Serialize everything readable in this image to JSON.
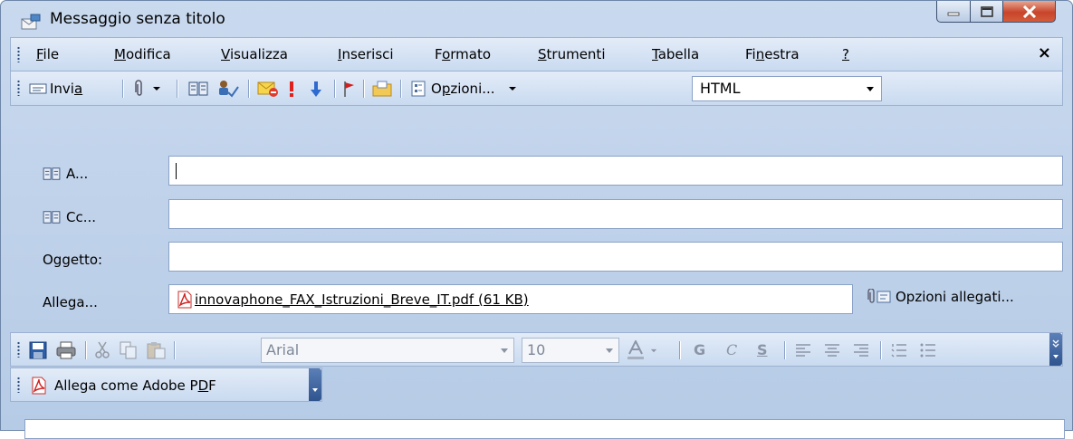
{
  "window": {
    "title": "Messaggio senza titolo"
  },
  "menu": {
    "items": [
      {
        "pre": "",
        "key": "F",
        "post": "ile"
      },
      {
        "pre": "",
        "key": "M",
        "post": "odifica"
      },
      {
        "pre": "",
        "key": "V",
        "post": "isualizza"
      },
      {
        "pre": "",
        "key": "I",
        "post": "nserisci"
      },
      {
        "pre": "F",
        "key": "o",
        "post": "rmato"
      },
      {
        "pre": "",
        "key": "S",
        "post": "trumenti"
      },
      {
        "pre": "",
        "key": "T",
        "post": "abella"
      },
      {
        "pre": "Fi",
        "key": "n",
        "post": "estra"
      },
      {
        "pre": "",
        "key": "?",
        "post": ""
      }
    ],
    "close": "×"
  },
  "toolbar": {
    "send_pre": "Invi",
    "send_key": "a",
    "options_pre": "O",
    "options_key": "p",
    "options_post": "zioni...",
    "format_value": "HTML"
  },
  "fields": {
    "to_label": "A...",
    "cc_label": "Cc...",
    "subject_label": "Oggetto:",
    "attach_label": "Allega...",
    "attachment": "innovaphone_FAX_Istruzioni_Breve_IT.pdf (61 KB)",
    "attach_options": "Opzioni allegati..."
  },
  "format": {
    "font": "Arial",
    "size": "10",
    "bold": "G",
    "italic": "C",
    "underline": "S"
  },
  "pdf_toolbar": {
    "pre": "Allega come Adobe P",
    "key": "D",
    "post": "F"
  },
  "colors": {
    "chrome": "#c9d9ee",
    "close_btn": "#c8442a",
    "pdf_red": "#d22020"
  }
}
